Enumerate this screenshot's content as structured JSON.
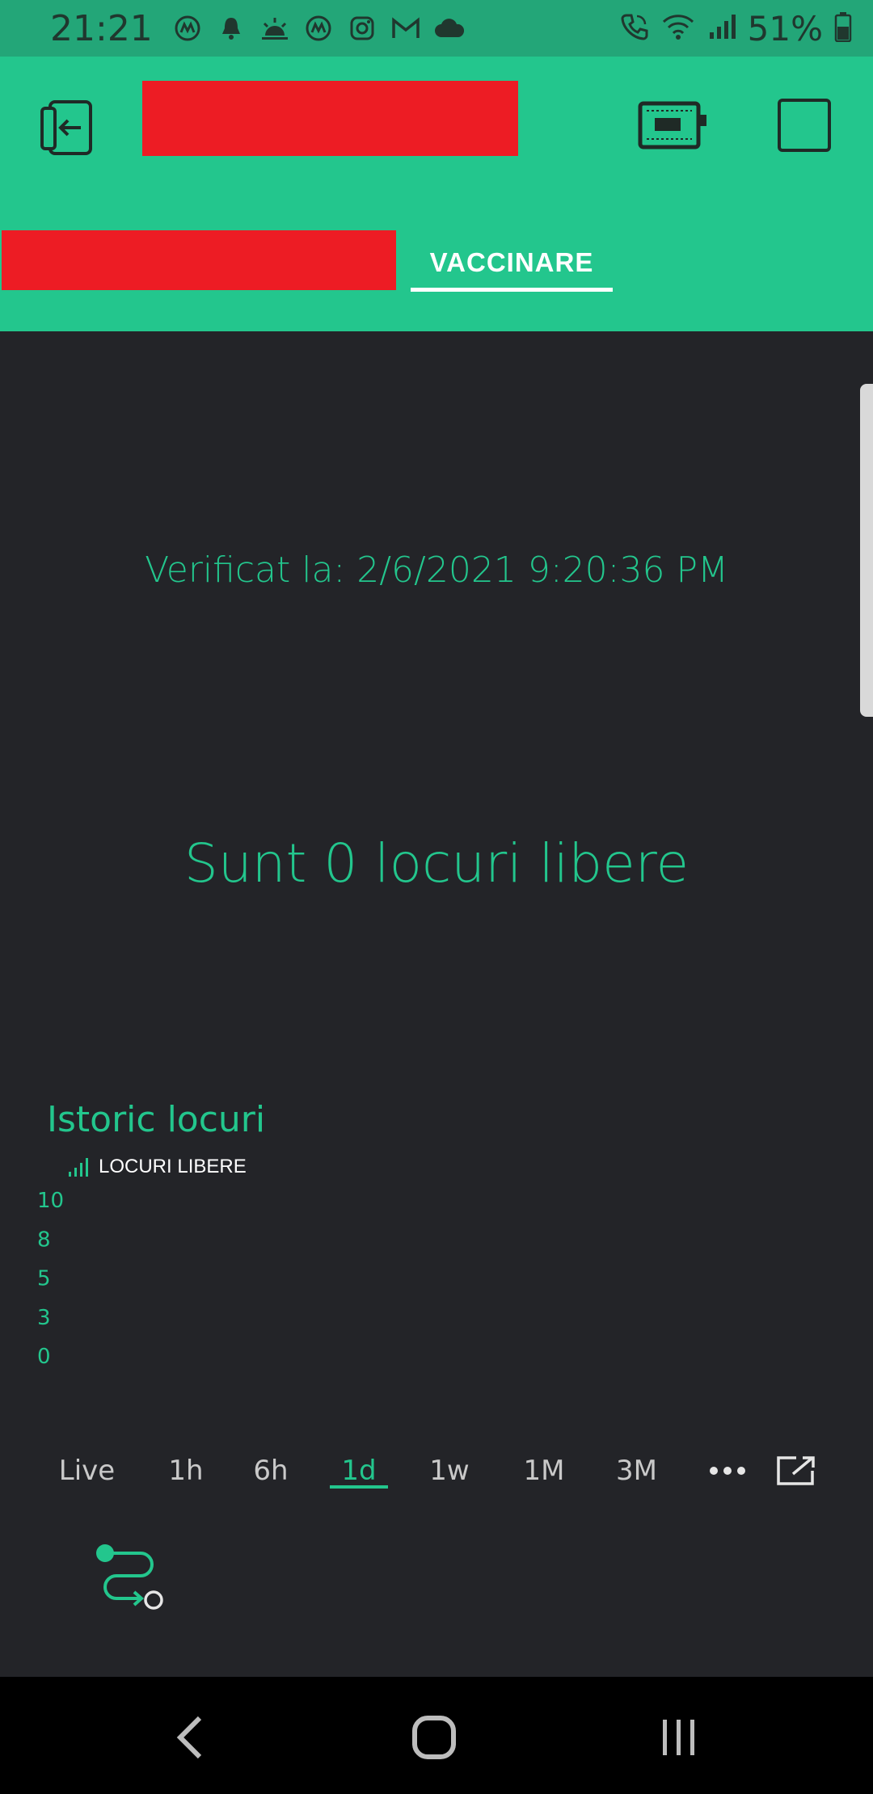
{
  "status_bar": {
    "time": "21:21",
    "battery": "51%",
    "notification_icons": [
      "coinmarketcap-icon",
      "bell-icon",
      "weather-icon",
      "coinmarketcap-icon",
      "instagram-icon",
      "gmail-icon",
      "cloud-icon"
    ],
    "right_icons": [
      "call-icon",
      "wifi-icon",
      "signal-icon",
      "battery-icon"
    ]
  },
  "header": {
    "tabs": [
      {
        "label": "",
        "redacted": true
      },
      {
        "label": "VACCINARE",
        "active": true
      }
    ]
  },
  "content": {
    "verified_label": "Verificat la: 2/6/2021 9:20:36 PM",
    "spots_label": "Sunt 0 locuri libere"
  },
  "chart_data": {
    "type": "bar",
    "title": "Istoric locuri",
    "series": [
      {
        "name": "LOCURI LIBERE",
        "values": []
      }
    ],
    "y_ticks": [
      "10",
      "8",
      "5",
      "3",
      "0"
    ],
    "ylim": [
      0,
      10
    ]
  },
  "time_ranges": {
    "items": [
      "Live",
      "1h",
      "6h",
      "1d",
      "1w",
      "1M",
      "3M"
    ],
    "active": "1d"
  },
  "colors": {
    "accent": "#23c68d",
    "background": "#232428",
    "status_bar": "#23a678"
  }
}
